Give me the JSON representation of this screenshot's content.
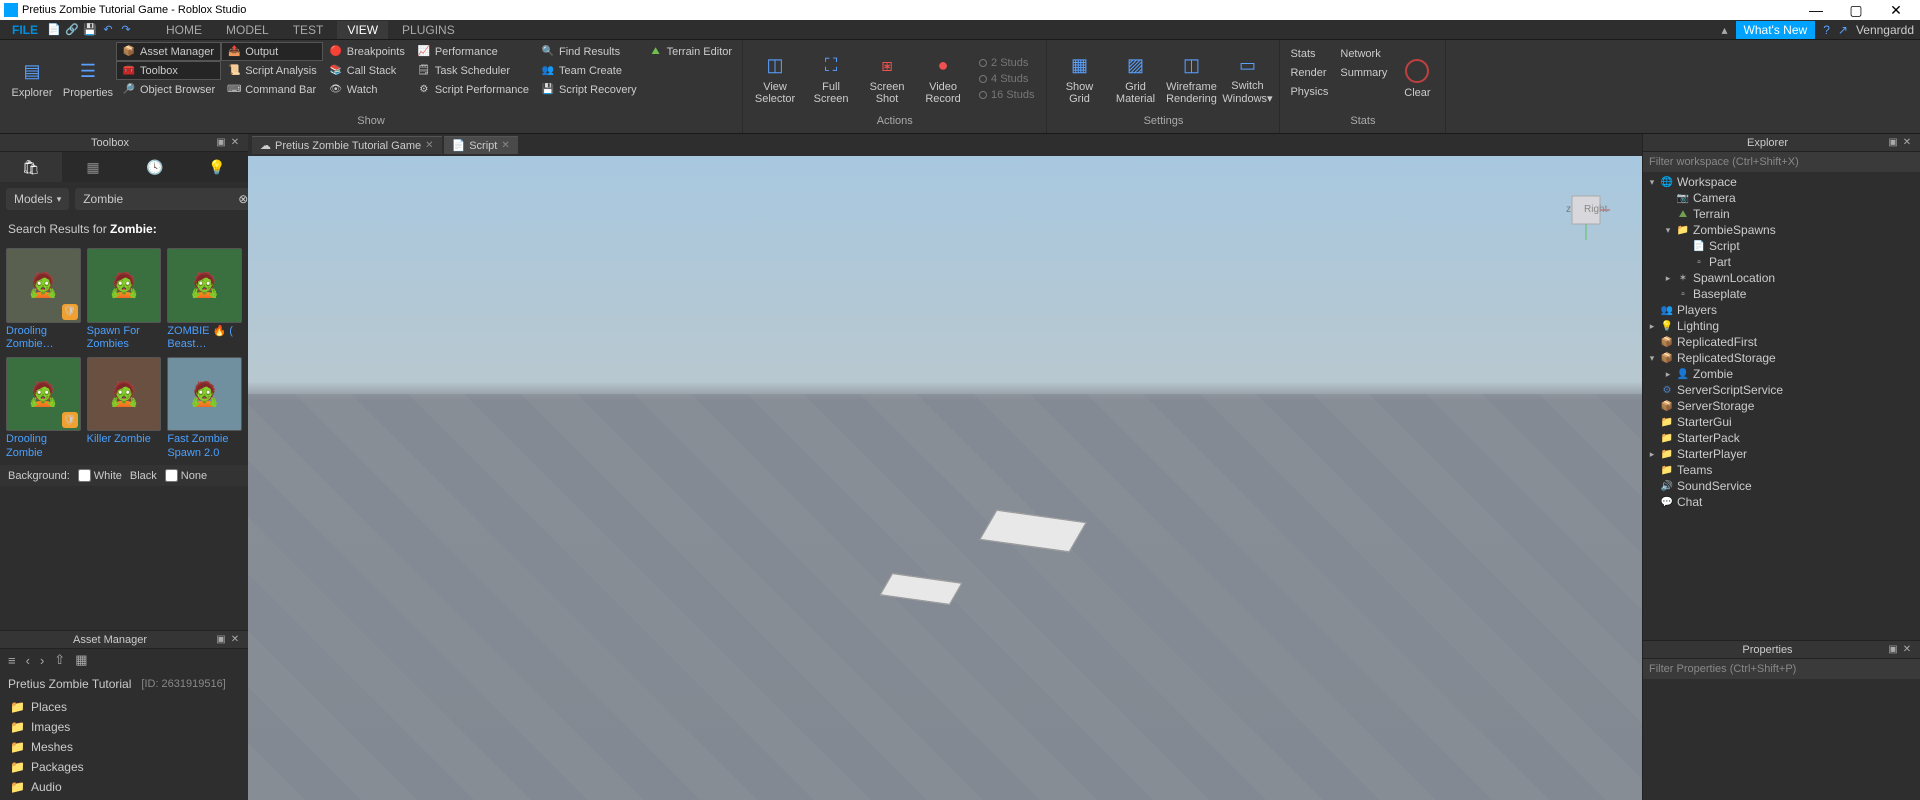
{
  "window": {
    "title": "Pretius Zombie Tutorial Game - Roblox Studio"
  },
  "menu": {
    "file": "FILE",
    "tabs": [
      "HOME",
      "MODEL",
      "TEST",
      "VIEW",
      "PLUGINS"
    ],
    "active_tab": "VIEW",
    "whats_new": "What's New",
    "username": "Venngardd"
  },
  "ribbon": {
    "explorer": "Explorer",
    "properties": "Properties",
    "col1": [
      {
        "icon": "📦",
        "label": "Asset Manager",
        "active": true
      },
      {
        "icon": "🧰",
        "label": "Toolbox",
        "active": true
      },
      {
        "icon": "🔎",
        "label": "Object Browser"
      }
    ],
    "col2": [
      {
        "icon": "📤",
        "label": "Output",
        "active": true
      },
      {
        "icon": "📜",
        "label": "Script Analysis"
      },
      {
        "icon": "⌨",
        "label": "Command Bar"
      }
    ],
    "col3": [
      {
        "icon": "🔴",
        "label": "Breakpoints"
      },
      {
        "icon": "📚",
        "label": "Call Stack"
      },
      {
        "icon": "👁",
        "label": "Watch"
      }
    ],
    "col4": [
      {
        "icon": "📈",
        "label": "Performance"
      },
      {
        "icon": "🗒",
        "label": "Task Scheduler"
      },
      {
        "icon": "⚙",
        "label": "Script Performance"
      }
    ],
    "col5": [
      {
        "icon": "🔍",
        "label": "Find Results"
      },
      {
        "icon": "👥",
        "label": "Team Create"
      },
      {
        "icon": "💾",
        "label": "Script Recovery"
      }
    ],
    "terrain": "Terrain Editor",
    "group_show": "Show",
    "actions": {
      "view_selector": "View\nSelector",
      "full_screen": "Full\nScreen",
      "screen_shot": "Screen\nShot",
      "video_record": "Video\nRecord",
      "label": "Actions"
    },
    "studs": [
      "2 Studs",
      "4 Studs",
      "16 Studs"
    ],
    "settings": {
      "show_grid": "Show\nGrid",
      "grid_material": "Grid\nMaterial",
      "wireframe": "Wireframe\nRendering",
      "switch_windows": "Switch\nWindows▾",
      "label": "Settings"
    },
    "stats": {
      "stats": "Stats",
      "network": "Network",
      "render": "Render",
      "summary": "Summary",
      "physics": "Physics",
      "clear": "Clear",
      "label": "Stats"
    }
  },
  "toolbox": {
    "title": "Toolbox",
    "dropdown": "Models",
    "search_value": "Zombie",
    "results_prefix": "Search Results for ",
    "results_term": "Zombie:",
    "items": [
      {
        "title": "Drooling Zombie…",
        "badge": true,
        "bg": "#5a6050"
      },
      {
        "title": "Spawn For Zombies",
        "badge": false,
        "bg": "#3a7040"
      },
      {
        "title": "ZOMBIE 🔥 ( Beast…",
        "badge": false,
        "bg": "#3a7040"
      },
      {
        "title": "Drooling Zombie",
        "badge": true,
        "bg": "#3a7040"
      },
      {
        "title": "Killer Zombie",
        "badge": false,
        "bg": "#6a5040"
      },
      {
        "title": "Fast Zombie Spawn 2.0",
        "badge": false,
        "bg": "#7090a0"
      }
    ],
    "bg_label": "Background:",
    "bg_white": "White",
    "bg_black": "Black",
    "bg_none": "None"
  },
  "assetmgr": {
    "title": "Asset Manager",
    "project": "Pretius Zombie Tutorial",
    "project_id": "[ID: 2631919516]",
    "folders": [
      "Places",
      "Images",
      "Meshes",
      "Packages",
      "Audio"
    ]
  },
  "doctabs": [
    {
      "icon": "☁",
      "label": "Pretius Zombie Tutorial Game",
      "active": false
    },
    {
      "icon": "📄",
      "label": "Script",
      "active": true
    }
  ],
  "viewport": {
    "axis_label": "Right"
  },
  "explorer": {
    "title": "Explorer",
    "filter_placeholder": "Filter workspace (Ctrl+Shift+X)",
    "tree": [
      {
        "d": 0,
        "arrow": "▾",
        "icon": "🌐",
        "c": "#4ac080",
        "label": "Workspace"
      },
      {
        "d": 1,
        "arrow": "",
        "icon": "📷",
        "c": "#5aa0ff",
        "label": "Camera"
      },
      {
        "d": 1,
        "arrow": "",
        "icon": "⛰",
        "c": "#70a050",
        "label": "Terrain"
      },
      {
        "d": 1,
        "arrow": "▾",
        "icon": "📁",
        "c": "#e0b050",
        "label": "ZombieSpawns"
      },
      {
        "d": 2,
        "arrow": "",
        "icon": "📄",
        "c": "#ddd",
        "label": "Script"
      },
      {
        "d": 2,
        "arrow": "",
        "icon": "▫",
        "c": "#ccc",
        "label": "Part"
      },
      {
        "d": 1,
        "arrow": "▸",
        "icon": "✶",
        "c": "#aaa",
        "label": "SpawnLocation"
      },
      {
        "d": 1,
        "arrow": "",
        "icon": "▫",
        "c": "#ccc",
        "label": "Baseplate"
      },
      {
        "d": 0,
        "arrow": "",
        "icon": "👥",
        "c": "#f08040",
        "label": "Players"
      },
      {
        "d": 0,
        "arrow": "▸",
        "icon": "💡",
        "c": "#f0d040",
        "label": "Lighting"
      },
      {
        "d": 0,
        "arrow": "",
        "icon": "📦",
        "c": "#d05050",
        "label": "ReplicatedFirst"
      },
      {
        "d": 0,
        "arrow": "▾",
        "icon": "📦",
        "c": "#d05050",
        "label": "ReplicatedStorage"
      },
      {
        "d": 1,
        "arrow": "▸",
        "icon": "👤",
        "c": "#70b0e0",
        "label": "Zombie"
      },
      {
        "d": 0,
        "arrow": "",
        "icon": "⚙",
        "c": "#5080c0",
        "label": "ServerScriptService"
      },
      {
        "d": 0,
        "arrow": "",
        "icon": "📦",
        "c": "#5080c0",
        "label": "ServerStorage"
      },
      {
        "d": 0,
        "arrow": "",
        "icon": "📁",
        "c": "#e0b050",
        "label": "StarterGui"
      },
      {
        "d": 0,
        "arrow": "",
        "icon": "📁",
        "c": "#e0b050",
        "label": "StarterPack"
      },
      {
        "d": 0,
        "arrow": "▸",
        "icon": "📁",
        "c": "#e0b050",
        "label": "StarterPlayer"
      },
      {
        "d": 0,
        "arrow": "",
        "icon": "📁",
        "c": "#e0b050",
        "label": "Teams"
      },
      {
        "d": 0,
        "arrow": "",
        "icon": "🔊",
        "c": "#aaa",
        "label": "SoundService"
      },
      {
        "d": 0,
        "arrow": "",
        "icon": "💬",
        "c": "#ddd",
        "label": "Chat"
      }
    ]
  },
  "properties": {
    "title": "Properties",
    "filter_placeholder": "Filter Properties (Ctrl+Shift+P)"
  }
}
